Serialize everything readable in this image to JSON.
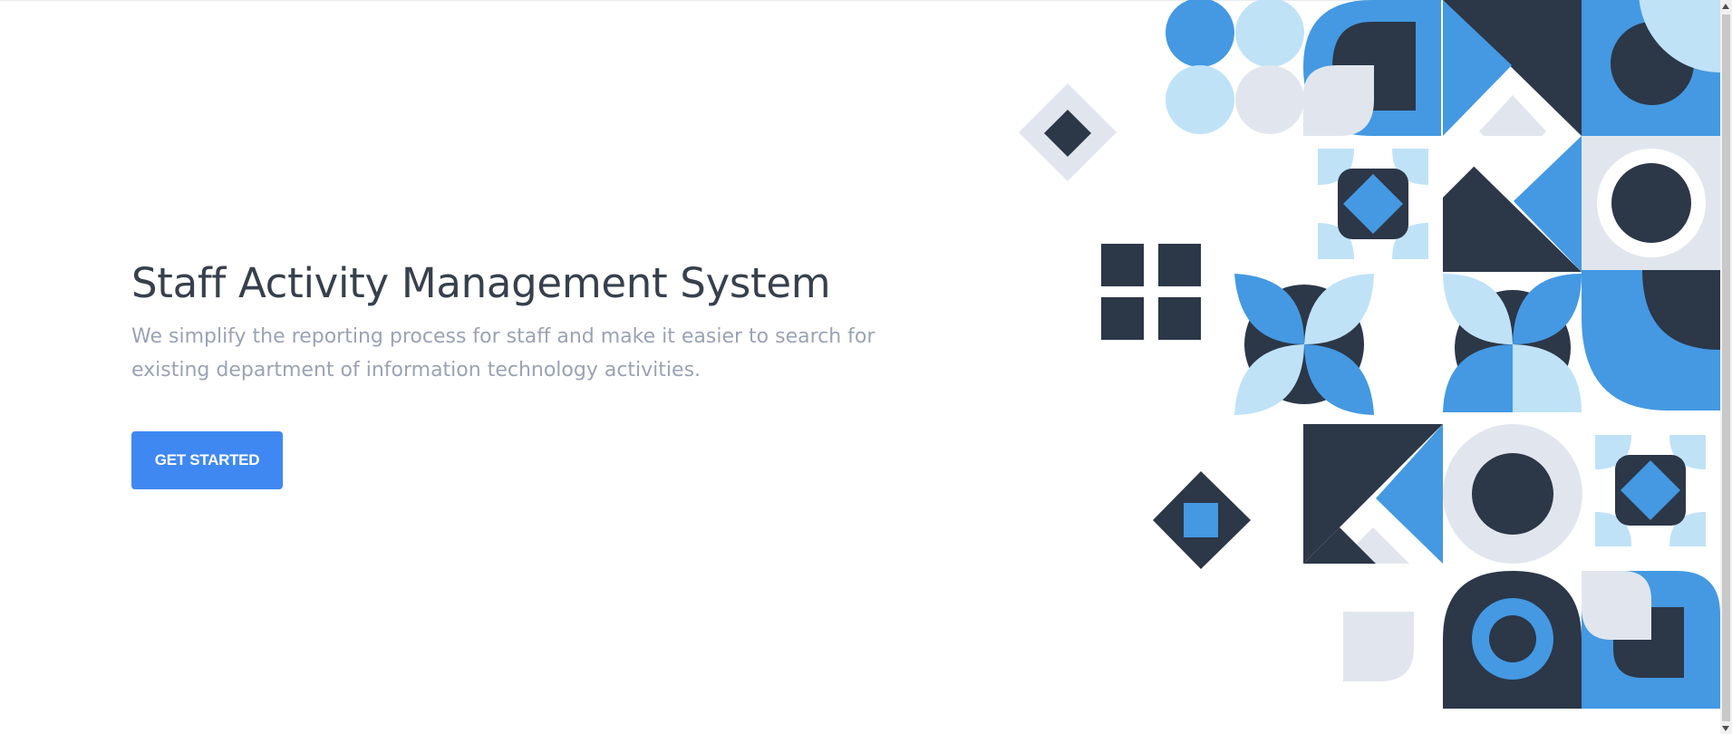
{
  "hero": {
    "title": "Staff Activity Management System",
    "description": "We simplify the reporting process for staff and make it easier to search for existing department of information technology activities.",
    "cta_label": "GET STARTED"
  },
  "colors": {
    "accent": "#3f88f2",
    "navy": "#2c3748",
    "blue": "#4499e2",
    "light_blue": "#bfe2f7",
    "pale_gray": "#e1e6ee",
    "title_text": "#37404d",
    "body_text": "#9aa3b5"
  },
  "illustration": {
    "icon": "geometric-pattern-illustration"
  }
}
